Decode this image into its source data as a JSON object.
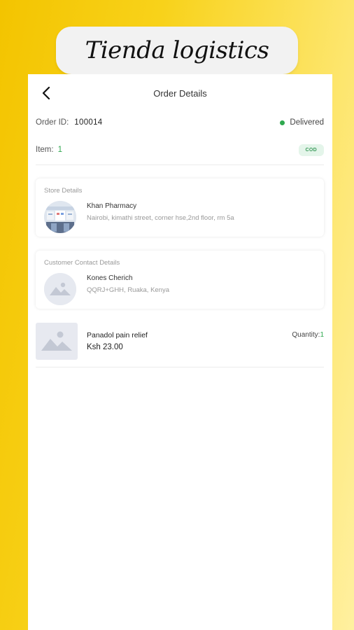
{
  "banner": {
    "title": "Tienda logistics"
  },
  "header": {
    "title": "Order Details"
  },
  "order": {
    "id_label": "Order ID:",
    "id_value": "100014",
    "status": "Delivered",
    "status_color": "#2fa84f",
    "item_label": "Item:",
    "item_count": "1",
    "payment_badge": "COD"
  },
  "store": {
    "section_title": "Store Details",
    "name": "Khan Pharmacy",
    "address": "Nairobi, kimathi street, corner hse,2nd floor, rm 5a",
    "avatar_icon": "pharmacy-store-photo"
  },
  "customer": {
    "section_title": "Customer Contact Details",
    "name": "Kones Cherich",
    "address": "QQRJ+GHH, Ruaka, Kenya",
    "avatar_icon": "image-placeholder-icon"
  },
  "product": {
    "name": "Panadol pain relief",
    "price": "Ksh 23.00",
    "quantity_label": "Quantity:",
    "quantity_value": "1",
    "thumb_icon": "image-placeholder-icon"
  },
  "colors": {
    "accent_green": "#2fa84f",
    "background_yellow": "#f3c400"
  }
}
